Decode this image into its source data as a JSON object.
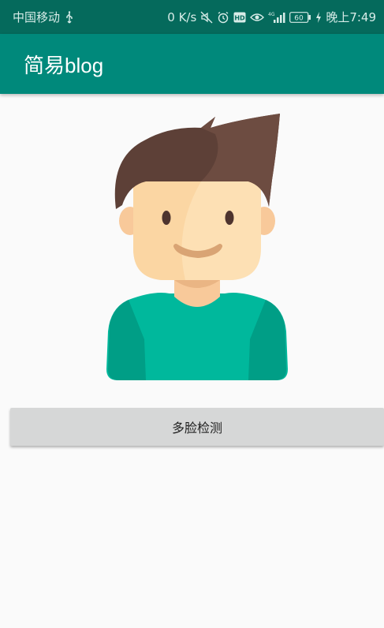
{
  "status_bar": {
    "carrier": "中国移动",
    "network_speed": "0 K/s",
    "network_type": "4G",
    "battery": "60",
    "time": "晚上7:49",
    "icons": [
      "usb-icon",
      "mute-icon",
      "alarm-icon",
      "hd-icon",
      "eye-icon",
      "signal-icon",
      "battery-icon",
      "charging-icon"
    ]
  },
  "app_bar": {
    "title": "简易blog",
    "color": "#00897b",
    "status_color": "#056a5c"
  },
  "main": {
    "avatar_icon": "cartoon-man-avatar",
    "detect_button_label": "多脸检测"
  }
}
